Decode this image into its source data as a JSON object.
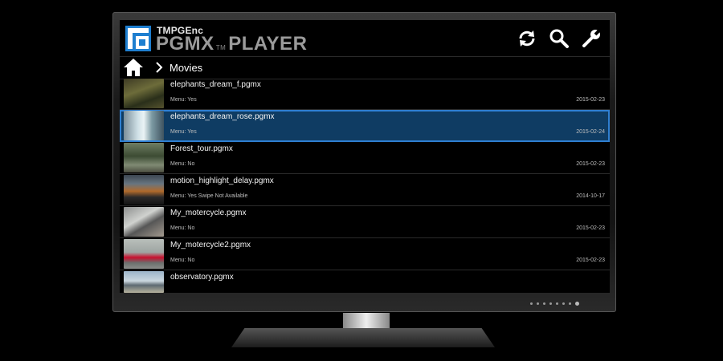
{
  "app": {
    "brand_top": "TMPGEnc",
    "brand_main": "PGMX",
    "brand_tm": "TM",
    "brand_sub": "PLAYER"
  },
  "header": {
    "icons": [
      "refresh-icon",
      "search-icon",
      "settings-wrench-icon"
    ]
  },
  "breadcrumb": {
    "home_icon": "home-icon",
    "separator_icon": "chevron-right-icon",
    "current": "Movies"
  },
  "files": [
    {
      "name": "elephants_dream_f.pgmx",
      "meta": "Menu: Yes",
      "date": "2015-02-23",
      "selected": false
    },
    {
      "name": "elephants_dream_rose.pgmx",
      "meta": "Menu: Yes",
      "date": "2015-02-24",
      "selected": true
    },
    {
      "name": "Forest_tour.pgmx",
      "meta": "Menu: No",
      "date": "2015-02-23",
      "selected": false
    },
    {
      "name": "motion_highlight_delay.pgmx",
      "meta": "Menu: Yes  Swipe Not Available",
      "date": "2014-10-17",
      "selected": false
    },
    {
      "name": "My_motercycle.pgmx",
      "meta": "Menu: No",
      "date": "2015-02-23",
      "selected": false
    },
    {
      "name": "My_motercycle2.pgmx",
      "meta": "Menu: No",
      "date": "2015-02-23",
      "selected": false
    },
    {
      "name": "observatory.pgmx",
      "meta": "",
      "date": "",
      "selected": false
    }
  ],
  "colors": {
    "selection_fill": "#0f3c63",
    "selection_border": "#2f7fd1",
    "logo_blue": "#1e7fd0"
  }
}
